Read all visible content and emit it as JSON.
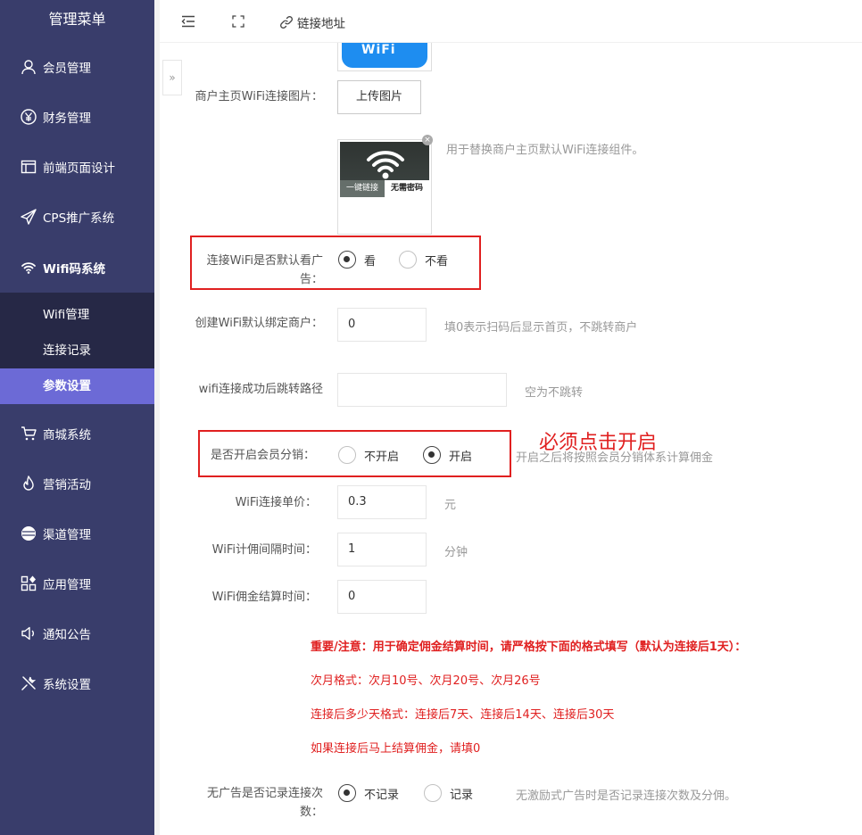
{
  "sidebar": {
    "title": "管理菜单",
    "items": [
      {
        "label": "会员管理",
        "icon": "user-icon"
      },
      {
        "label": "财务管理",
        "icon": "yen-icon"
      },
      {
        "label": "前端页面设计",
        "icon": "layout-icon"
      },
      {
        "label": "CPS推广系统",
        "icon": "send-icon"
      },
      {
        "label": "Wifi码系统",
        "icon": "wifi-icon"
      },
      {
        "label": "商城系统",
        "icon": "cart-icon"
      },
      {
        "label": "营销活动",
        "icon": "fire-icon"
      },
      {
        "label": "渠道管理",
        "icon": "circle-icon"
      },
      {
        "label": "应用管理",
        "icon": "apps-icon"
      },
      {
        "label": "通知公告",
        "icon": "speaker-icon"
      },
      {
        "label": "系统设置",
        "icon": "tools-icon"
      }
    ],
    "submenu": [
      {
        "label": "Wifi管理"
      },
      {
        "label": "连接记录"
      },
      {
        "label": "参数设置"
      }
    ]
  },
  "topbar": {
    "link_label": "链接地址"
  },
  "thumb": {
    "top_text": "WiFi",
    "caption_left": "一键链接",
    "caption_right": "无需密码"
  },
  "form": {
    "wifi_image_label": "商户主页WiFi连接图片：",
    "upload_button": "上传图片",
    "wifi_image_hint": "用于替换商户主页默认WiFi连接组件。",
    "ad_label": "连接WiFi是否默认看广告：",
    "ad_options": [
      "看",
      "不看"
    ],
    "ad_selected": "看",
    "bind_label": "创建WiFi默认绑定商户：",
    "bind_value": "0",
    "bind_hint": "填0表示扫码后显示首页，不跳转商户",
    "redirect_label": "wifi连接成功后跳转路径",
    "redirect_value": "",
    "redirect_hint": "空为不跳转",
    "commission_label": "是否开启会员分销：",
    "commission_options": [
      "不开启",
      "开启"
    ],
    "commission_selected": "开启",
    "commission_hint": "开启之后将按照会员分销体系计算佣金",
    "annotation": "必须点击开启",
    "price_label": "WiFi连接单价：",
    "price_value": "0.3",
    "price_unit": "元",
    "interval_label": "WiFi计佣间隔时间：",
    "interval_value": "1",
    "interval_unit": "分钟",
    "settle_label": "WiFi佣金结算时间：",
    "settle_value": "0",
    "notes": [
      "重要/注意：用于确定佣金结算时间，请严格按下面的格式填写（默认为连接后1天）：",
      "次月格式：次月10号、次月20号、次月26号",
      "连接后多少天格式：连接后7天、连接后14天、连接后30天",
      "如果连接后马上结算佣金，请填0"
    ],
    "noad_label": "无广告是否记录连接次数：",
    "noad_options": [
      "不记录",
      "记录"
    ],
    "noad_selected": "不记录",
    "noad_hint": "无激励式广告时是否记录连接次数及分佣。"
  },
  "colors": {
    "sidebar_bg": "#393d6b",
    "submenu_bg": "#262846",
    "active_bg": "#6c6ad6",
    "alert_red": "#e02020"
  }
}
